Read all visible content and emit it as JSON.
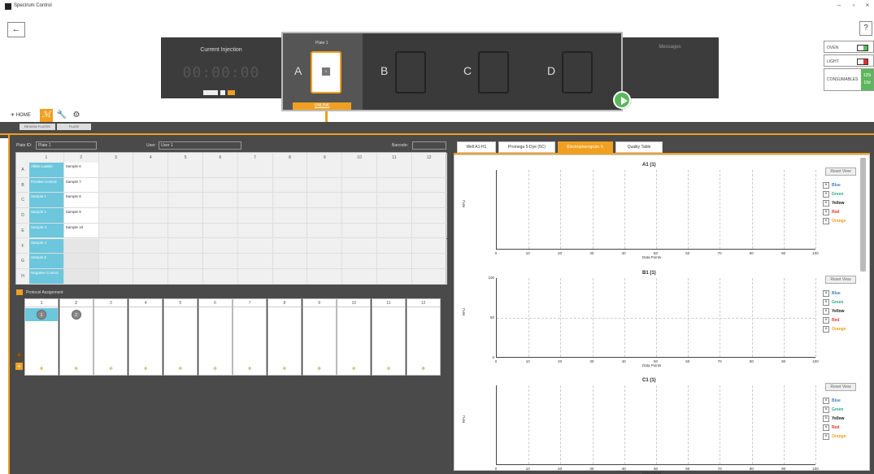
{
  "window": {
    "title": "Spectrum Control",
    "minimize": "–",
    "maximize": "▫",
    "close": "×"
  },
  "header": {
    "back": "←",
    "help": "?",
    "current_injection": {
      "title": "Current Injection",
      "time": "00:00:00"
    },
    "messages_title": "Messages",
    "plates": {
      "selected_name": "Plate 1",
      "slot_labels": [
        "A",
        "B",
        "C",
        "D"
      ],
      "card_label": "1",
      "unlink": "UNLINK"
    },
    "status": {
      "oven": "OVEN",
      "light": "LIGHT",
      "consumables": "CONSUMABLES",
      "consumables_value_1": "125i",
      "consumables_value_2": "10d",
      "colors": {
        "oven": "#5cb85c",
        "light": "#e03030"
      }
    }
  },
  "nav": {
    "home": "HOME",
    "breadcrumbs": [
      "REVIEW PLATES",
      "PLATE"
    ]
  },
  "plate_form": {
    "plate_id_label": "Plate ID:",
    "plate_id_value": "Plate 1",
    "user_label": "User:",
    "user_value": "User 1",
    "barcode_label": "Barcode:",
    "barcode_value": ""
  },
  "plate_grid": {
    "columns": [
      "1",
      "2",
      "3",
      "4",
      "5",
      "6",
      "7",
      "8",
      "9",
      "10",
      "11",
      "12"
    ],
    "rows": [
      "A",
      "B",
      "C",
      "D",
      "E",
      "F",
      "G",
      "H"
    ],
    "col1": [
      "Allelic Ladder",
      "Positive Control",
      "Sample 1",
      "Sample 2",
      "Sample 3",
      "Sample 4",
      "Sample 5",
      "Negative Control"
    ],
    "col2": [
      "Sample 6",
      "Sample 7",
      "Sample 8",
      "Sample 9",
      "Sample 10"
    ]
  },
  "protocol": {
    "title": "Protocol Assignment",
    "columns": [
      "1",
      "2",
      "3",
      "4",
      "5",
      "6",
      "7",
      "8",
      "9",
      "10",
      "11",
      "12"
    ],
    "badges": [
      "1",
      "2"
    ],
    "plus": "+",
    "remove": "×"
  },
  "tabs": [
    {
      "label": "Well A1-H1"
    },
    {
      "label": "Promega 5-Dye (5C)"
    },
    {
      "label": "Electropherogram"
    },
    {
      "label": "Quality Table"
    }
  ],
  "edit_icon": "✎",
  "charts": {
    "reset_label": "Reset View",
    "xlabel": "Data Points",
    "ylabel": "RFU",
    "xticks": [
      "0",
      "10",
      "20",
      "30",
      "40",
      "50",
      "60",
      "70",
      "80",
      "90",
      "100"
    ],
    "legend": [
      {
        "name": "Blue",
        "color": "#3a7fc4"
      },
      {
        "name": "Green",
        "color": "#2aa88a"
      },
      {
        "name": "Yellow",
        "color": "#111111"
      },
      {
        "name": "Red",
        "color": "#e03030"
      },
      {
        "name": "Orange",
        "color": "#f0a020"
      }
    ],
    "check": "×",
    "panels": [
      {
        "title": "A1 (1)",
        "yticks": []
      },
      {
        "title": "B1 (1)",
        "yticks": [
          "100",
          "50",
          "0"
        ]
      },
      {
        "title": "C1 (1)",
        "yticks": []
      }
    ]
  }
}
